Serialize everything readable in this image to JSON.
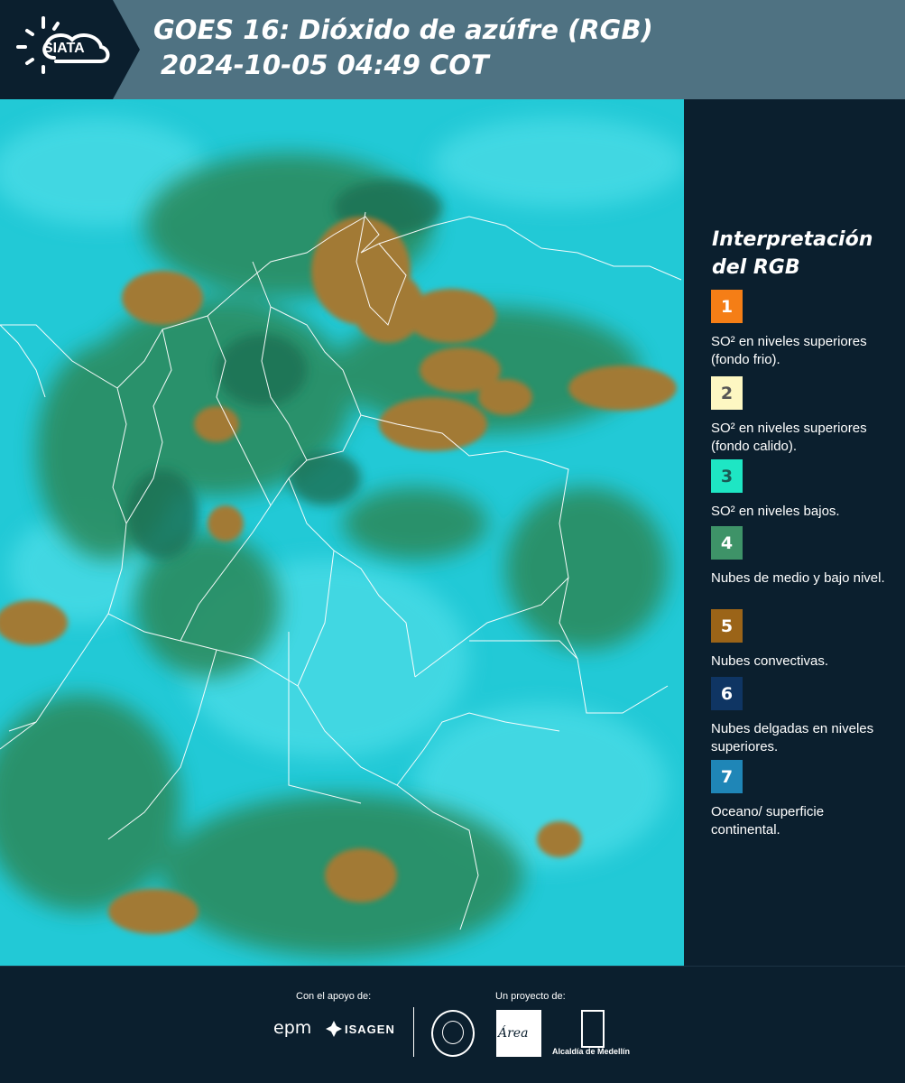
{
  "header": {
    "logo_text": "SIATA",
    "title_line1": "GOES 16: Dióxido de azúfre (RGB)",
    "title_line2": "2024-10-05 04:49 COT"
  },
  "legend": {
    "title": "Interpretación del RGB",
    "items": [
      {
        "number": "1",
        "color": "#f57e16",
        "text_color": "#ffffff",
        "label": "SO² en niveles superiores (fondo frio)."
      },
      {
        "number": "2",
        "color": "#fdf7c2",
        "text_color": "#555555",
        "label": "SO² en niveles superiores (fondo calido)."
      },
      {
        "number": "3",
        "color": "#1ee6c4",
        "text_color": "#1a5a55",
        "label": "SO² en niveles bajos."
      },
      {
        "number": "4",
        "color": "#3e9368",
        "text_color": "#ffffff",
        "label": "Nubes de medio y bajo nivel."
      },
      {
        "number": "5",
        "color": "#9b6418",
        "text_color": "#ffffff",
        "label": "Nubes convectivas."
      },
      {
        "number": "6",
        "color": "#0f3563",
        "text_color": "#ffffff",
        "label": "Nubes delgadas en niveles superiores."
      },
      {
        "number": "7",
        "color": "#1f86b7",
        "text_color": "#ffffff",
        "label": "Oceano/ superficie continental."
      }
    ]
  },
  "footer": {
    "support_label": "Con el apoyo de:",
    "project_label": "Un proyecto de:",
    "epm": "epm",
    "isagen": "ISAGEN",
    "area": "Área",
    "alcaldia": "Alcaldía de Medellín"
  },
  "colors": {
    "background": "#0b1f2e",
    "header": "#4f7282",
    "map_cyan": "#20c8d4",
    "map_green": "#2f8f62",
    "map_convective": "#a77a33"
  }
}
